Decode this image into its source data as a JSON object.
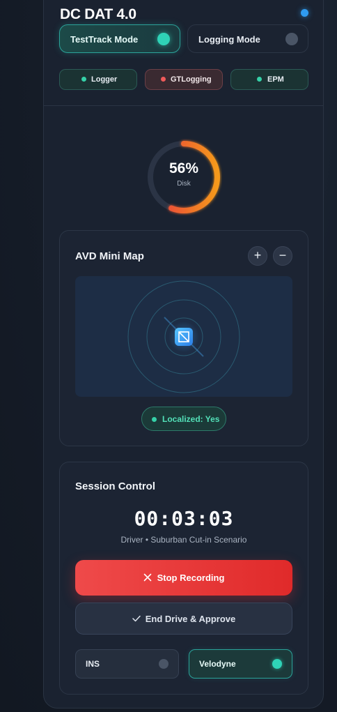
{
  "app": {
    "title": "DC DAT 4.0"
  },
  "modes": [
    {
      "label": "TestTrack Mode",
      "active": true
    },
    {
      "label": "Logging Mode",
      "active": false
    }
  ],
  "chips": [
    {
      "label": "Logger",
      "color": "#35d1a8"
    },
    {
      "label": "GTLogging",
      "color": "#ef5a5a"
    },
    {
      "label": "EPM",
      "color": "#35d1a8"
    }
  ],
  "disk": {
    "value_text": "56%",
    "label": "Disk",
    "percent": 56
  },
  "map": {
    "title": "AVD Mini Map",
    "zoom_in_label": "+",
    "zoom_out_label": "−",
    "localized_text": "Localized: Yes"
  },
  "session": {
    "title": "Session Control",
    "timer": "00:03:03",
    "subtitle": "Driver • Suburban Cut-in Scenario",
    "stop_label": "Stop Recording",
    "end_label": "End Drive & Approve"
  },
  "sensors": [
    {
      "label": "INS",
      "active": false
    },
    {
      "label": "Velodyne",
      "active": true
    }
  ],
  "colors": {
    "accent_teal": "#2fd3b7",
    "danger_red": "#e02a2a",
    "status_blue": "#2f9bf0"
  }
}
